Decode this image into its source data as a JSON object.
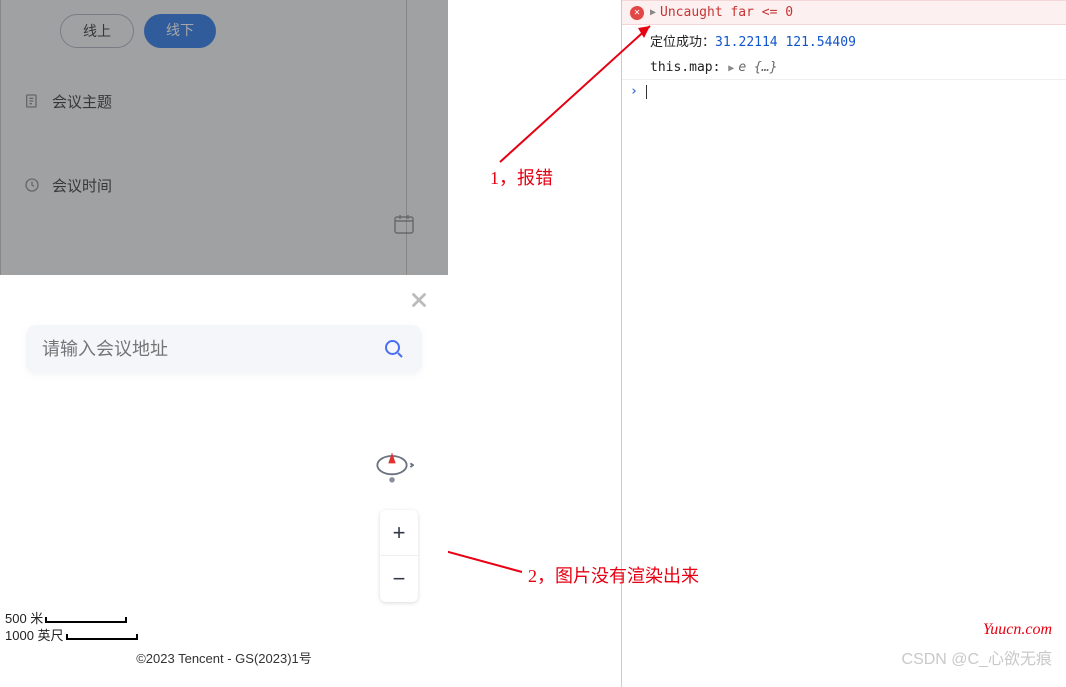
{
  "form": {
    "tab_online": "线上",
    "tab_offline": "线下",
    "topic_label": "会议主题",
    "time_label": "会议时间"
  },
  "sheet": {
    "search_placeholder": "请输入会议地址",
    "zoom_in": "+",
    "zoom_out": "−",
    "scale_m": "500 米",
    "scale_ft": "1000 英尺",
    "copyright": "©2023 Tencent - GS(2023)1号"
  },
  "console": {
    "error": "Uncaught far <= 0",
    "log_prefix": "定位成功：",
    "coords": "31.22114 121.54409",
    "map_label": "this.map:",
    "map_val": "e {…}"
  },
  "anno": {
    "a1": "1，报错",
    "a2": "2，图片没有渲染出来"
  },
  "wm": {
    "w1": "Yuucn.com",
    "w2": "CSDN @C_心欲无痕"
  }
}
